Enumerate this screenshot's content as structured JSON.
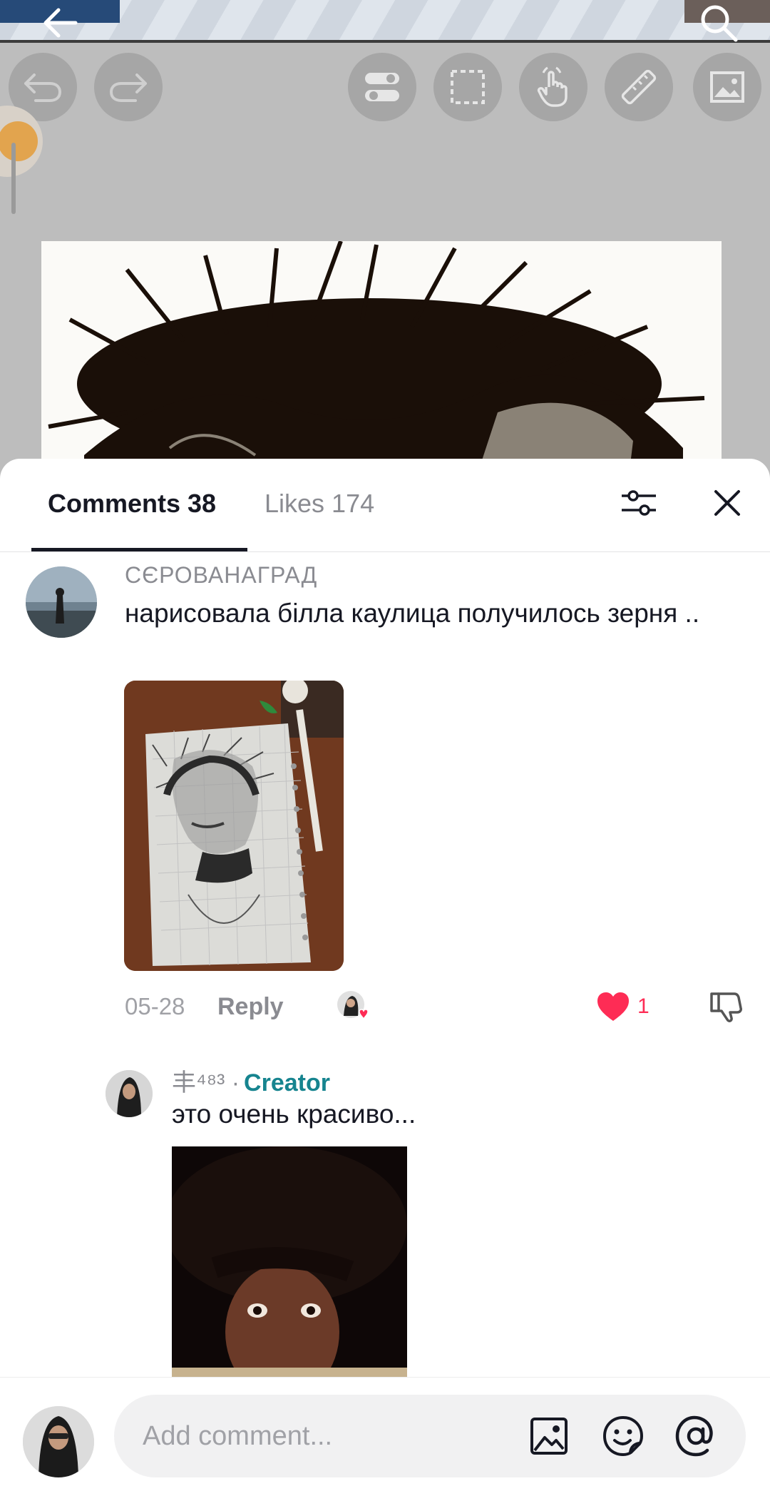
{
  "video": {
    "icons": [
      "back-arrow-icon",
      "search-icon",
      "undo-icon",
      "redo-icon",
      "toggle-icon",
      "selection-icon",
      "hand-gesture-icon",
      "ruler-icon",
      "image-icon"
    ]
  },
  "tabs": {
    "comments_label": "Comments 38",
    "likes_label": "Likes 174"
  },
  "comment": {
    "username": "CЄРОВАНАГРАД",
    "text": "нарисовала білла каулица получилось зерня ..",
    "date": "05-28",
    "reply_label": "Reply",
    "like_count": "1",
    "liked": true
  },
  "reply": {
    "username": "丰⁴⁸³ ·",
    "creator_label": "Creator",
    "text": "это очень красиво..."
  },
  "composer": {
    "placeholder": "Add comment..."
  },
  "colors": {
    "like_red": "#fe2c55",
    "creator_teal": "#16848f",
    "text_dark": "#161823",
    "text_muted": "#8a8b91"
  }
}
